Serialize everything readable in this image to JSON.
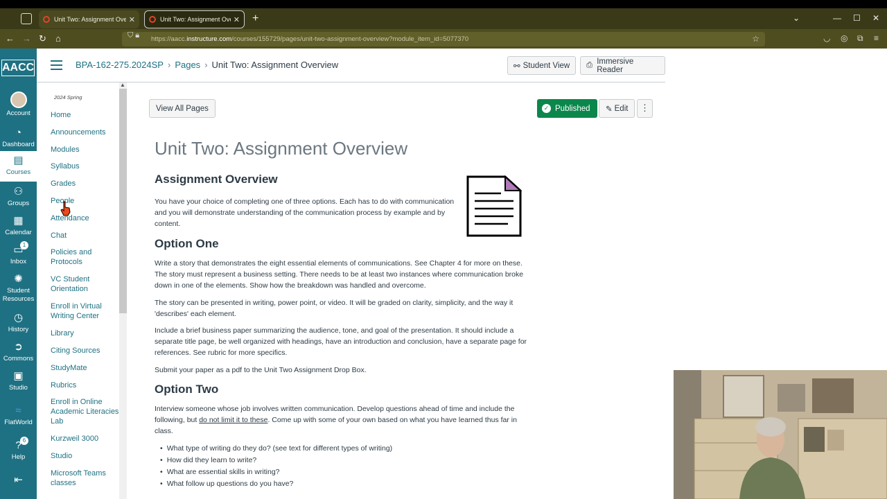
{
  "browser": {
    "tabs": [
      {
        "title": "Unit Two: Assignment Overview"
      },
      {
        "title": "Unit Two: Assignment Overview"
      }
    ],
    "url_prefix": "https://aacc.",
    "url_host": "instructure.com",
    "url_path": "/courses/155729/pages/unit-two-assignment-overview?module_item_id=5077370"
  },
  "global_nav": {
    "logo": "AACC",
    "items": [
      {
        "label": "Account",
        "icon": "avatar"
      },
      {
        "label": "Dashboard",
        "icon": "dashboard-icon"
      },
      {
        "label": "Courses",
        "icon": "courses-icon"
      },
      {
        "label": "Groups",
        "icon": "groups-icon"
      },
      {
        "label": "Calendar",
        "icon": "calendar-icon"
      },
      {
        "label": "Inbox",
        "icon": "inbox-icon",
        "badge": "1"
      },
      {
        "label": "Student Resources",
        "icon": "resources-icon"
      },
      {
        "label": "History",
        "icon": "history-icon"
      },
      {
        "label": "Commons",
        "icon": "commons-icon"
      },
      {
        "label": "Studio",
        "icon": "studio-icon"
      },
      {
        "label": "FlatWorld",
        "icon": "flatworld-icon"
      },
      {
        "label": "Help",
        "icon": "help-icon",
        "badge": "6"
      }
    ]
  },
  "header": {
    "course": "BPA-162-275.2024SP",
    "pages": "Pages",
    "current": "Unit Two: Assignment Overview",
    "student_view": "Student View",
    "immersive_reader": "Immersive Reader"
  },
  "course_nav": {
    "term": "2024 Spring",
    "items": [
      "Home",
      "Announcements",
      "Modules",
      "Syllabus",
      "Grades",
      "People",
      "Attendance",
      "Chat",
      "Policies and Protocols",
      "VC Student Orientation",
      "Enroll in Virtual Writing Center",
      "Library",
      "Citing Sources",
      "StudyMate",
      "Rubrics",
      "Enroll in Online Academic Literacies Lab",
      "Kurzweil 3000",
      "Studio",
      "Microsoft Teams classes"
    ]
  },
  "page": {
    "view_all": "View All Pages",
    "published": "Published",
    "edit": "Edit",
    "more": "⋮",
    "title": "Unit Two: Assignment Overview",
    "h_overview": "Assignment Overview",
    "overview_p": "You have your choice of completing one of three options. Each has to do with communication and you will demonstrate understanding of the communication process by example and by content.",
    "h_option1": "Option One",
    "opt1_p1": "Write a story that demonstrates the eight essential elements of communications. See Chapter 4 for more on these. The story must represent a business setting. There needs to be at least two instances where communication broke down in one of the elements. Show how the breakdown was handled and overcome.",
    "opt1_p2": "The story can be presented in writing, power point, or video. It will be graded on clarity, simplicity, and the way it 'describes' each element.",
    "opt1_p3": "Include a brief business paper summarizing the audience, tone, and goal of the presentation. It should include a separate title page, be well organized with headings, have an introduction and conclusion, have a separate page for references. See rubric for more specifics.",
    "opt1_p4": "Submit your paper as a pdf to the Unit Two Assignment Drop Box.",
    "h_option2": "Option Two",
    "opt2_p1a": "Interview someone whose job involves written communication. Develop questions ahead of time and include the following, but ",
    "opt2_p1u": "do not limit it to these",
    "opt2_p1b": ". Come up with some of your own based on what you have learned thus far in class.",
    "bullets": [
      "What type of writing do they do? (see text for different types of writing)",
      "How did they learn to write?",
      "What are essential skills in writing?",
      "What follow up questions do you have?"
    ]
  },
  "colors": {
    "brand": "#1e7183",
    "published": "#0b874b"
  }
}
